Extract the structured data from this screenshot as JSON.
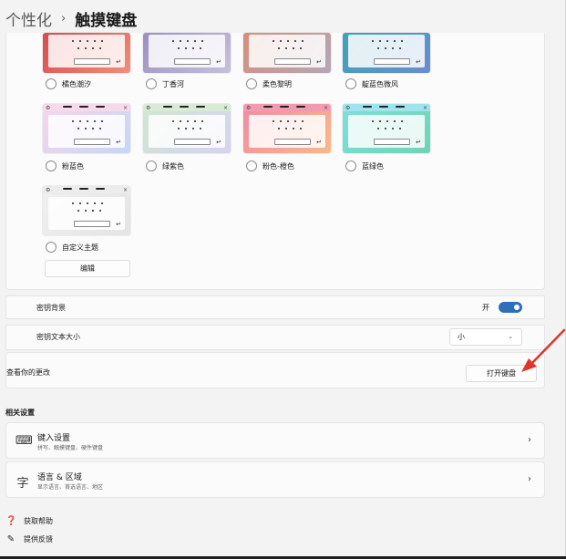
{
  "breadcrumb": {
    "parent": "个性化",
    "separator": "›",
    "current": "触摸键盘"
  },
  "themes": [
    {
      "label": "橘色潮汐",
      "top": "#f3b7b0",
      "bg1": "#d64a4f",
      "bg2": "#f08f7a",
      "partial": true
    },
    {
      "label": "丁香河",
      "top": "#d3d0e4",
      "bg1": "#9b8fc2",
      "bg2": "#c7c1dc",
      "partial": true
    },
    {
      "label": "柔色黎明",
      "top": "#f3d8cf",
      "bg1": "#d98d7a",
      "bg2": "#b5a7b8",
      "partial": true
    },
    {
      "label": "靛蓝色微风",
      "top": "#c9d8ee",
      "bg1": "#3da4b4",
      "bg2": "#6b8cd1",
      "partial": true
    },
    {
      "label": "粉蓝色",
      "top": "#f6d9ea",
      "bg1": "#f7d6e8",
      "bg2": "#c6d6f6",
      "partial": false
    },
    {
      "label": "绿紫色",
      "top": "#d8ecd5",
      "bg1": "#cfe8cf",
      "bg2": "#d6d2f2",
      "partial": false
    },
    {
      "label": "粉色-橙色",
      "top": "#f29ab2",
      "bg1": "#f28aa2",
      "bg2": "#f7b98a",
      "partial": false
    },
    {
      "label": "蓝绿色",
      "top": "#9fe3ec",
      "bg1": "#7fe0d8",
      "bg2": "#6fd4b5",
      "partial": false
    },
    {
      "label": "自定义主题",
      "top": "#ececec",
      "bg1": "#f0f0f0",
      "bg2": "#e4e4e4",
      "partial": false
    }
  ],
  "tile_glyphs": {
    "gear": "⚙",
    "close": "×",
    "enter": "↵"
  },
  "edit_button": "编辑",
  "key_background": {
    "label": "密钥背景",
    "state": "开"
  },
  "key_text_size": {
    "label": "密钥文本大小",
    "value": "小",
    "chevron": "⌄"
  },
  "review": {
    "label": "查看你的更改",
    "button": "打开键盘"
  },
  "related": {
    "title": "相关设置",
    "items": [
      {
        "title": "键入设置",
        "subtitle": "拼写、触摸键盘、硬件键盘",
        "icon": "⌨",
        "chevron": "›"
      },
      {
        "title": "语言 & 区域",
        "subtitle": "显示语言、首选语言、地区",
        "icon": "字",
        "chevron": "›"
      }
    ]
  },
  "links": [
    {
      "label": "获取帮助",
      "icon": "❓"
    },
    {
      "label": "提供反馈",
      "icon": "✎"
    }
  ],
  "colors": {
    "accent": "#2d6fb8",
    "arrow": "#e0352b"
  }
}
